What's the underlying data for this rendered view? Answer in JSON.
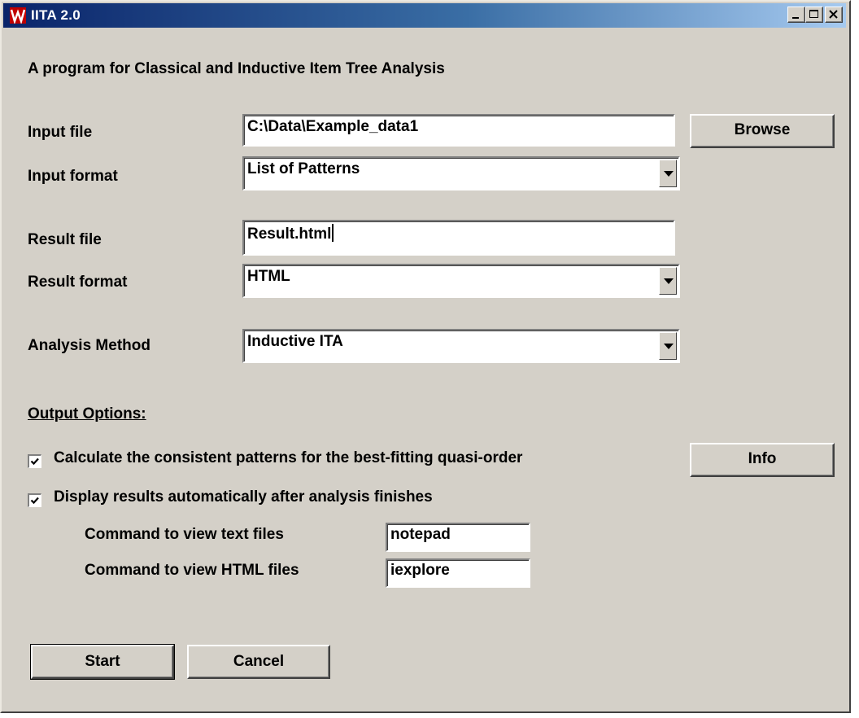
{
  "window": {
    "title": "IITA 2.0"
  },
  "subtitle": "A program for Classical and Inductive Item Tree Analysis",
  "input_file": {
    "label": "Input file",
    "value": "C:\\Data\\Example_data1",
    "browse_label": "Browse"
  },
  "input_format": {
    "label": "Input format",
    "selected": "List of Patterns"
  },
  "result_file": {
    "label": "Result file",
    "value": "Result.html"
  },
  "result_format": {
    "label": "Result format",
    "selected": "HTML"
  },
  "analysis_method": {
    "label": "Analysis Method",
    "selected": "Inductive ITA"
  },
  "output_options": {
    "heading": "Output Options:",
    "calc_patterns": {
      "label": "Calculate the consistent patterns for the best-fitting quasi-order",
      "checked": true
    },
    "info_label": "Info",
    "display_results": {
      "label": "Display results automatically after analysis finishes",
      "checked": true
    },
    "text_cmd": {
      "label": "Command to view text files",
      "value": "notepad"
    },
    "html_cmd": {
      "label": "Command to view HTML files",
      "value": "iexplore"
    }
  },
  "actions": {
    "start_label": "Start",
    "cancel_label": "Cancel"
  },
  "icons": [
    "app-icon",
    "minimize-icon",
    "maximize-icon",
    "close-icon",
    "dropdown-arrow-icon",
    "checkmark-icon"
  ]
}
